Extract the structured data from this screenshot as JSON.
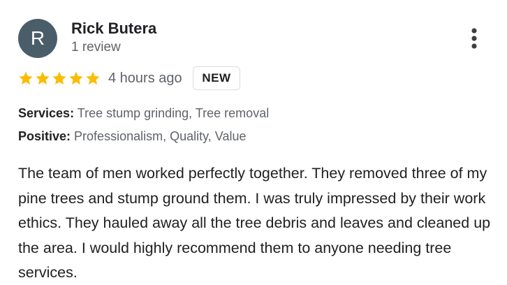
{
  "reviewer": {
    "initial": "R",
    "name": "Rick Butera",
    "review_count": "1 review",
    "avatar_color": "#4a5e6a"
  },
  "rating": {
    "stars": 5,
    "max_stars": 5,
    "star_color": "#fbbc04",
    "time_ago": "4 hours ago",
    "badge": "NEW"
  },
  "attributes": {
    "services_label": "Services:",
    "services_value": "Tree stump grinding, Tree removal",
    "positive_label": "Positive:",
    "positive_value": "Professionalism, Quality, Value"
  },
  "review_text": "The team of men worked perfectly together. They removed three of my pine trees and stump ground them. I was truly impressed by their work ethics. They hauled away all the tree debris and leaves and cleaned up the area. I would highly recommend them to anyone needing tree services.",
  "icons": {
    "more": "more-vert-icon",
    "star": "star-icon"
  }
}
